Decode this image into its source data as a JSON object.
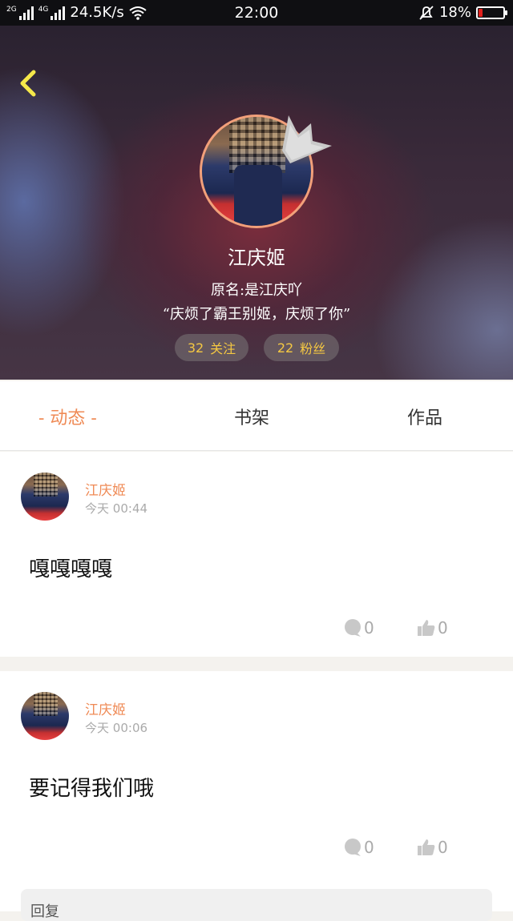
{
  "status_bar": {
    "net_left": "2G",
    "net_right": "4G",
    "speed": "24.5K/s",
    "time": "22:00",
    "battery": "18%",
    "battery_level": 0.18,
    "battery_color": "#e0201c"
  },
  "profile": {
    "name": "江庆姬",
    "bio_line1": "原名:是江庆吖",
    "bio_line2": "“庆烦了霸王别姬，庆烦了你”",
    "following_count": "32",
    "following_label": "关注",
    "fans_count": "22",
    "fans_label": "粉丝",
    "accent_color": "#ef8a55",
    "stat_color": "#f5c842"
  },
  "tabs": {
    "dynamic": "- 动态 -",
    "shelf": "书架",
    "works": "作品"
  },
  "posts": [
    {
      "author": "江庆姬",
      "time_prefix": "今天",
      "time": "00:44",
      "content": "嘎嘎嘎嘎",
      "comments": "0",
      "likes": "0"
    },
    {
      "author": "江庆姬",
      "time_prefix": "今天",
      "time": "00:06",
      "content": "要记得我们哦",
      "comments": "0",
      "likes": "0"
    }
  ],
  "reply_box": {
    "label": "回复"
  },
  "icons": [
    "back-icon",
    "crown-icon",
    "wifi-icon",
    "silent-bell-icon",
    "battery-icon",
    "comment-icon",
    "like-icon"
  ]
}
